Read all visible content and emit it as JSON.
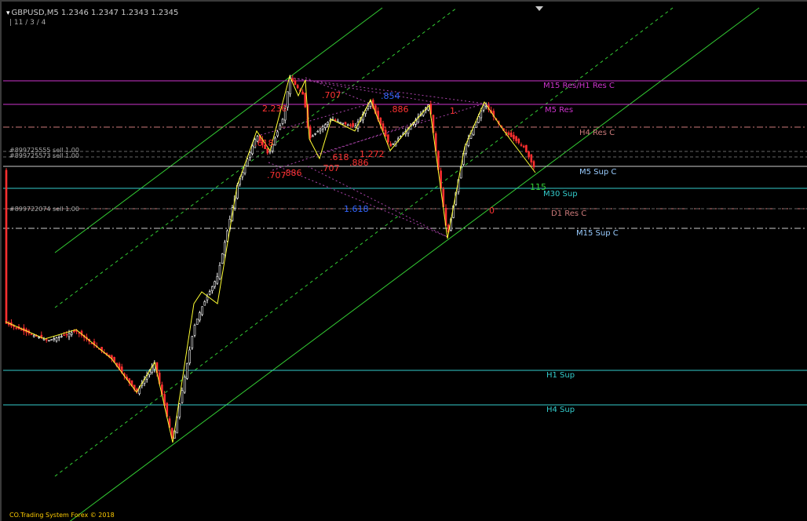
{
  "header": {
    "symbol_line": "GBPUSD,M5  1.2346 1.2347 1.2343 1.2345",
    "sub_line": "11 / 3 / 4"
  },
  "footer": {
    "copyright": "CO.Trading System Forex © 2018"
  },
  "colors": {
    "background": "#000000",
    "bull_candle": "#ffffff",
    "bear_candle": "#ff3030",
    "zigzag": "#ffff33",
    "channel": "#33cc33",
    "resistance_magenta": "#cc33cc",
    "support_cyan": "#33cccc",
    "resistance_brown": "#cc7a7a"
  },
  "levels": [
    {
      "label": "M15 Res/H1 Res C",
      "color": "#cc33cc"
    },
    {
      "label": "M5 Res",
      "color": "#cc33cc"
    },
    {
      "label": "H4 Res C",
      "color": "#cc7a7a"
    },
    {
      "label": "M5 Sup C",
      "color": "#99ccff"
    },
    {
      "label": "M30 Sup",
      "color": "#33cccc"
    },
    {
      "label": "D1 Res C",
      "color": "#cc7a7a"
    },
    {
      "label": "M15 Sup C",
      "color": "#99ccff"
    },
    {
      "label": "H1 Sup",
      "color": "#33cccc"
    },
    {
      "label": "H4 Sup",
      "color": "#33cccc"
    }
  ],
  "orders": [
    {
      "label": "#899725555 sell 1.00"
    },
    {
      "label": "#899725573 sell 1.00"
    },
    {
      "label": "#899722074 sell 1.00"
    }
  ],
  "fib_labels": [
    {
      "text": "2.236",
      "color": "#ff3333"
    },
    {
      "text": ".707",
      "color": "#ff3333"
    },
    {
      "text": ".854",
      "color": "#3366ff"
    },
    {
      "text": ".886",
      "color": "#ff3333"
    },
    {
      "text": "1.",
      "color": "#ff3333"
    },
    {
      "text": ".618",
      "color": "#ff3333"
    },
    {
      "text": ".618",
      "color": "#ff3333"
    },
    {
      "text": "1.272",
      "color": "#ff3333"
    },
    {
      "text": ".886",
      "color": "#ff3333"
    },
    {
      "text": ".707",
      "color": "#ff3333"
    },
    {
      "text": ".886",
      "color": "#ff3333"
    },
    {
      "text": ".707",
      "color": "#ff3333"
    },
    {
      "text": "1.618",
      "color": "#3366ff"
    },
    {
      "text": "0",
      "color": "#ff3333"
    },
    {
      "text": "115",
      "color": "#33cc33"
    }
  ]
}
